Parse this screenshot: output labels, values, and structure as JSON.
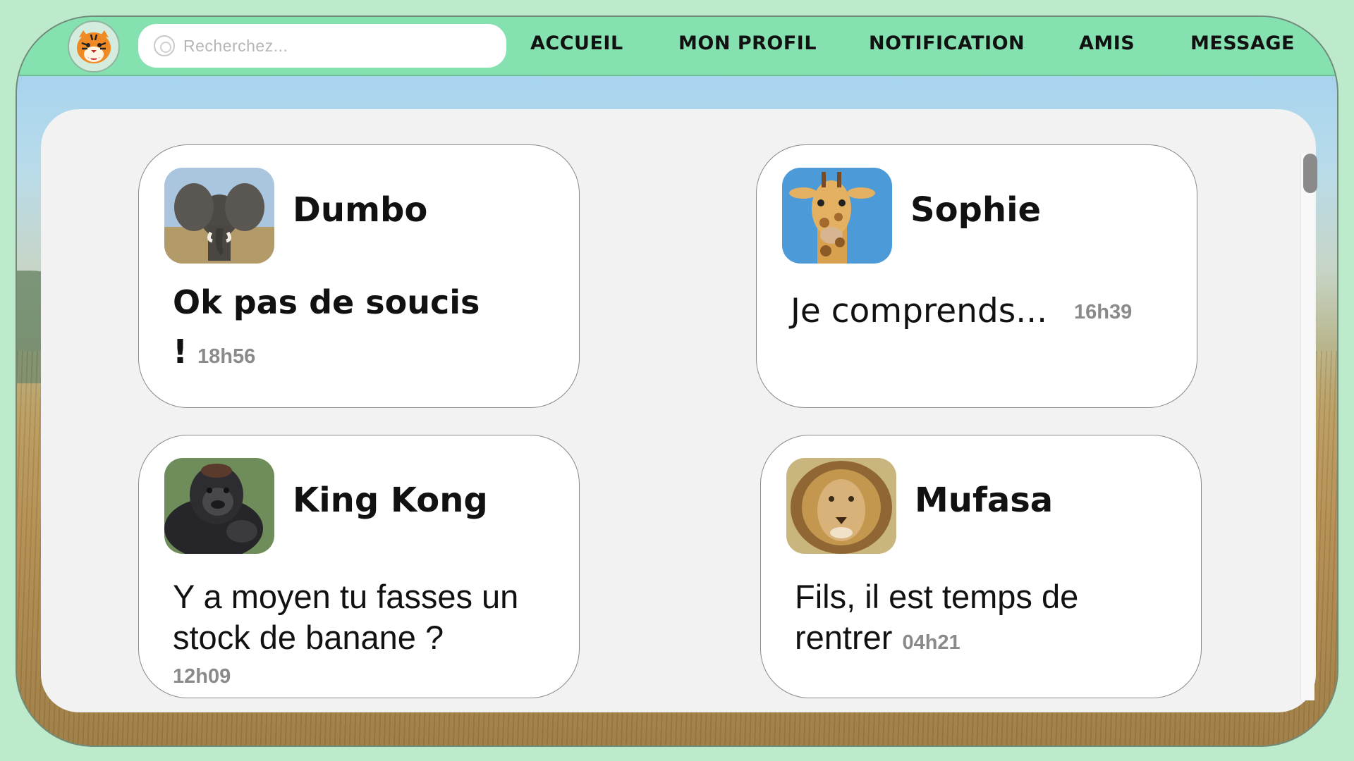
{
  "nav": {
    "logo_icon": "tiger-logo-icon",
    "search": {
      "placeholder": "Recherchez..."
    },
    "items": [
      "ACCUEIL",
      "MON PROFIL",
      "NOTIFICATION",
      "AMIS",
      "MESSAGE"
    ]
  },
  "colors": {
    "page_bg": "#bdeacb",
    "navbar": "#86e1b0",
    "panel": "#f2f2f2",
    "card": "#ffffff",
    "time": "#8a8a8a"
  },
  "conversations": [
    {
      "name": "Dumbo",
      "avatar": "elephant-icon",
      "message": "Ok pas de soucis !",
      "time": "18h56"
    },
    {
      "name": "Sophie",
      "avatar": "giraffe-icon",
      "message": "Je comprends...",
      "time": "16h39"
    },
    {
      "name": "King Kong",
      "avatar": "gorilla-icon",
      "message": "Y a moyen tu fasses un stock de banane ?",
      "time": "12h09"
    },
    {
      "name": "Mufasa",
      "avatar": "lion-icon",
      "message": "Fils, il est temps de rentrer",
      "time": "04h21"
    }
  ]
}
